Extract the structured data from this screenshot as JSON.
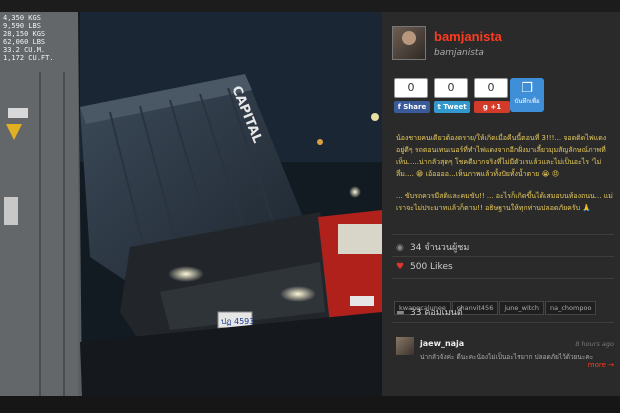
{
  "profile": {
    "username": "bamjanista",
    "handle": "bamjanista"
  },
  "share": {
    "facebook": {
      "count": "0",
      "label": "Share"
    },
    "twitter": {
      "count": "0",
      "label": "Tweet"
    },
    "gplus": {
      "count": "0",
      "label": "+1"
    },
    "save_label": "บันทึกเพื่อ"
  },
  "caption": {
    "p1": "น้องชายคนเดียวต้องตราย/ให้เกิดเมื่อคืนนี้ตอนที่ 3!!!... จอดติดไฟแดงอยู่ดีๆ รถตอนเทนเนอร์ที่ทำไฟแดงจากอีกฝั่งมาเลี้ยวมุมสัญลักษณ์ภาพที่เห็น.....น่ากลัวสุดๆ โชคดีมากจริงที่ไม่มีตัวเรแล้วและไม่เป็นอะไร 'ไม่ลึ่ม.... 😁 เอ้ออออ...เห็นภาพแล้วทั้งปัยทั้งน้ำตาย 😭 😠",
    "p2": "... ขับรถควรมีสติและคมขับ!! ... อะไรก็เกิดขึ้นได้เสมอบนท้องถนน... แม่เราจะไม่ประมาทแล้วก็ตาม!! อธิษฐานให้ทุกท่านปลอดภัยครับ 🙏"
  },
  "stats": {
    "views": "34 จำนวนผู้ชม",
    "likes": "500 Likes",
    "comments": "33 คอมเมนต์"
  },
  "tags": [
    "kwangcalunee",
    "chanvit456",
    "june_witch",
    "na_chompoo"
  ],
  "comment": {
    "user": "jaew_naja",
    "time": "8 hours ago",
    "text": "น่ากลัวจังค่ะ ดีนะคะน้องไม่เป็นอะไรมาก ปลอดภัยไว้ด้วยนะคะ",
    "more": "more →"
  },
  "photo": {
    "container_brand": "CAPITAL",
    "plate_text": "ปฏ 4593",
    "side_labels": [
      "4,350 KGS",
      "9,590 LBS",
      "28,150 KGS",
      "62,060 LBS",
      "33.2 CU.M.",
      "1,172 CU.FT."
    ]
  },
  "colors": {
    "brand_red": "#ff3b1f",
    "caption_yellow": "#e6c95a",
    "panel_bg": "#2a2a2a"
  }
}
